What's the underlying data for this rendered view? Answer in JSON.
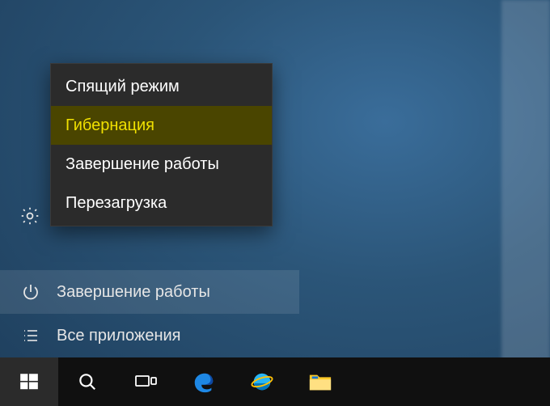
{
  "power_menu": {
    "items": [
      {
        "label": "Спящий режим",
        "state": ""
      },
      {
        "label": "Гибернация",
        "state": "hover"
      },
      {
        "label": "Завершение работы",
        "state": ""
      },
      {
        "label": "Перезагрузка",
        "state": ""
      }
    ]
  },
  "start_rail": {
    "power_label": "Завершение работы",
    "all_apps_label": "Все приложения"
  },
  "taskbar": {
    "start": "windows-logo",
    "search": "search-icon",
    "task_view": "task-view-icon",
    "edge": "edge-icon",
    "ie": "ie-icon",
    "explorer": "file-explorer-icon"
  }
}
